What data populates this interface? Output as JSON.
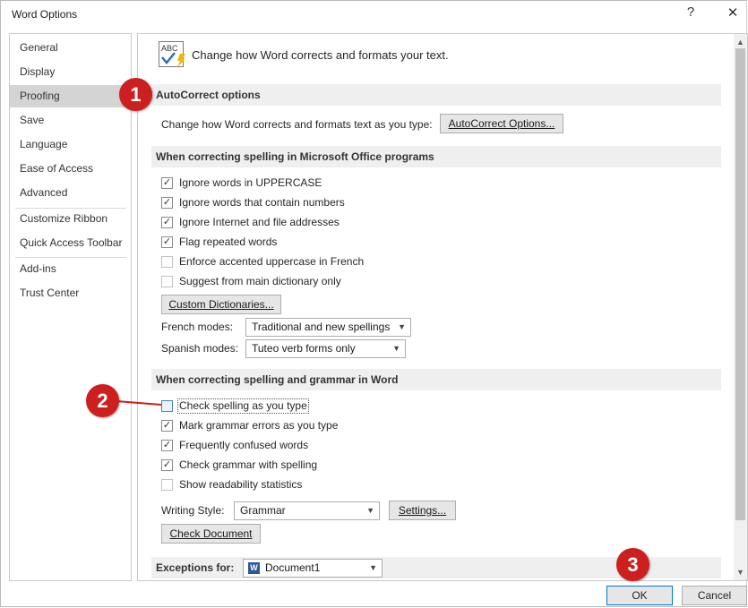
{
  "window": {
    "title": "Word Options",
    "help_glyph": "?",
    "close_glyph": "✕"
  },
  "sidebar": {
    "items": [
      {
        "label": "General"
      },
      {
        "label": "Display"
      },
      {
        "label": "Proofing",
        "selected": true
      },
      {
        "label": "Save"
      },
      {
        "label": "Language"
      },
      {
        "label": "Ease of Access"
      },
      {
        "label": "Advanced"
      },
      {
        "label": "Customize Ribbon"
      },
      {
        "label": "Quick Access Toolbar"
      },
      {
        "label": "Add-ins"
      },
      {
        "label": "Trust Center"
      }
    ]
  },
  "header": {
    "icon_text": "ABC",
    "text": "Change how Word corrects and formats your text."
  },
  "autocorrect": {
    "section_title": "AutoCorrect options",
    "description": "Change how Word corrects and formats text as you type:",
    "button_label": "AutoCorrect Options..."
  },
  "office_spelling": {
    "section_title": "When correcting spelling in Microsoft Office programs",
    "options": [
      {
        "label": "Ignore words in UPPERCASE",
        "checked": true
      },
      {
        "label": "Ignore words that contain numbers",
        "checked": true
      },
      {
        "label": "Ignore Internet and file addresses",
        "checked": true
      },
      {
        "label": "Flag repeated words",
        "checked": true
      },
      {
        "label": "Enforce accented uppercase in French",
        "checked": false
      },
      {
        "label": "Suggest from main dictionary only",
        "checked": false
      }
    ],
    "custom_dict_button": "Custom Dictionaries...",
    "french_modes_label": "French modes:",
    "french_modes_value": "Traditional and new spellings",
    "spanish_modes_label": "Spanish modes:",
    "spanish_modes_value": "Tuteo verb forms only"
  },
  "word_spelling": {
    "section_title": "When correcting spelling and grammar in Word",
    "options": [
      {
        "label": "Check spelling as you type",
        "checked": false
      },
      {
        "label": "Mark grammar errors as you type",
        "checked": true
      },
      {
        "label": "Frequently confused words",
        "checked": true
      },
      {
        "label": "Check grammar with spelling",
        "checked": true
      },
      {
        "label": "Show readability statistics",
        "checked": false
      }
    ],
    "writing_style_label": "Writing Style:",
    "writing_style_value": "Grammar",
    "settings_button": "Settings...",
    "check_document_button": "Check Document"
  },
  "exceptions": {
    "label": "Exceptions for:",
    "value": "Document1"
  },
  "footer": {
    "ok_label": "OK",
    "cancel_label": "Cancel"
  },
  "callouts": [
    "1",
    "2",
    "3"
  ],
  "colors": {
    "callout": "#cc1f1f",
    "section_bg": "#efefef",
    "selected_nav": "#d4d4d4",
    "ok_border": "#0078d7"
  }
}
